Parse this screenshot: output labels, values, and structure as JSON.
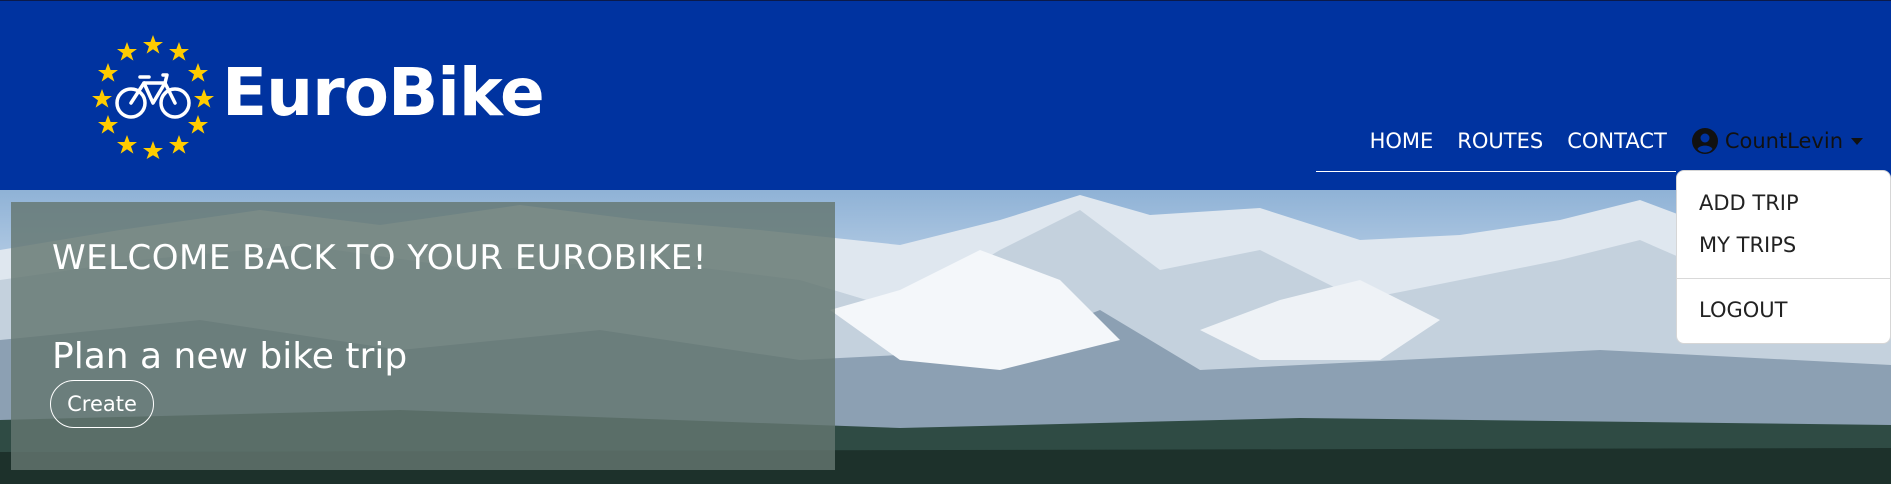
{
  "brand": {
    "name": "EuroBike",
    "logo_icon": "bicycle-with-eu-stars-icon"
  },
  "nav": {
    "links": [
      "HOME",
      "ROUTES",
      "CONTACT"
    ],
    "user": {
      "name": "CountLevin",
      "icon": "user-circle-icon"
    }
  },
  "dropdown": {
    "items": [
      "ADD TRIP",
      "MY TRIPS"
    ],
    "logout": "LOGOUT"
  },
  "hero": {
    "welcome": "WELCOME BACK TO YOUR EUROBIKE!",
    "plan": "Plan a new bike trip",
    "create_button": "Create"
  },
  "colors": {
    "navbar": "#0033a0",
    "star": "#ffcc00",
    "overlay": "#647670"
  }
}
